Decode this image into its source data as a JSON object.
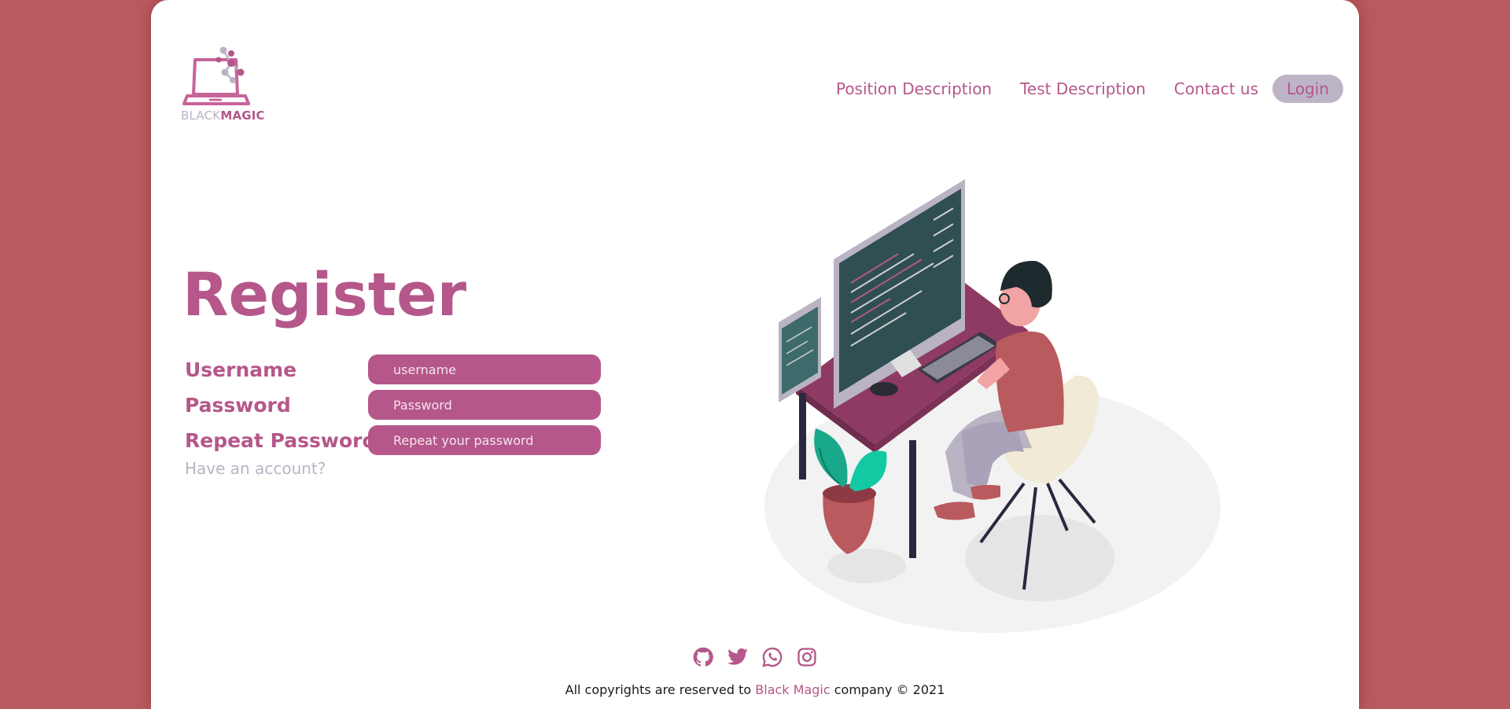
{
  "logo": {
    "text_black": "BLACK",
    "text_magic": "MAGIC"
  },
  "nav": {
    "items": [
      {
        "label": "Position Description"
      },
      {
        "label": "Test Description"
      },
      {
        "label": "Contact us"
      }
    ],
    "login_label": "Login"
  },
  "main": {
    "title": "Register",
    "fields": [
      {
        "label": "Username",
        "placeholder": "username"
      },
      {
        "label": "Password",
        "placeholder": "Password"
      },
      {
        "label": "Repeat Password",
        "placeholder": "Repeat your password"
      }
    ],
    "have_account": "Have an account?"
  },
  "social": {
    "icons": [
      "github-icon",
      "twitter-icon",
      "whatsapp-icon",
      "instagram-icon"
    ]
  },
  "footer": {
    "prefix": "All copyrights are reserved to ",
    "brand": "Black Magic",
    "suffix": " company © 2021"
  },
  "colors": {
    "background": "#b95a5e",
    "accent": "#b5578a",
    "muted": "#b9b3c4",
    "card": "#ffffff"
  }
}
